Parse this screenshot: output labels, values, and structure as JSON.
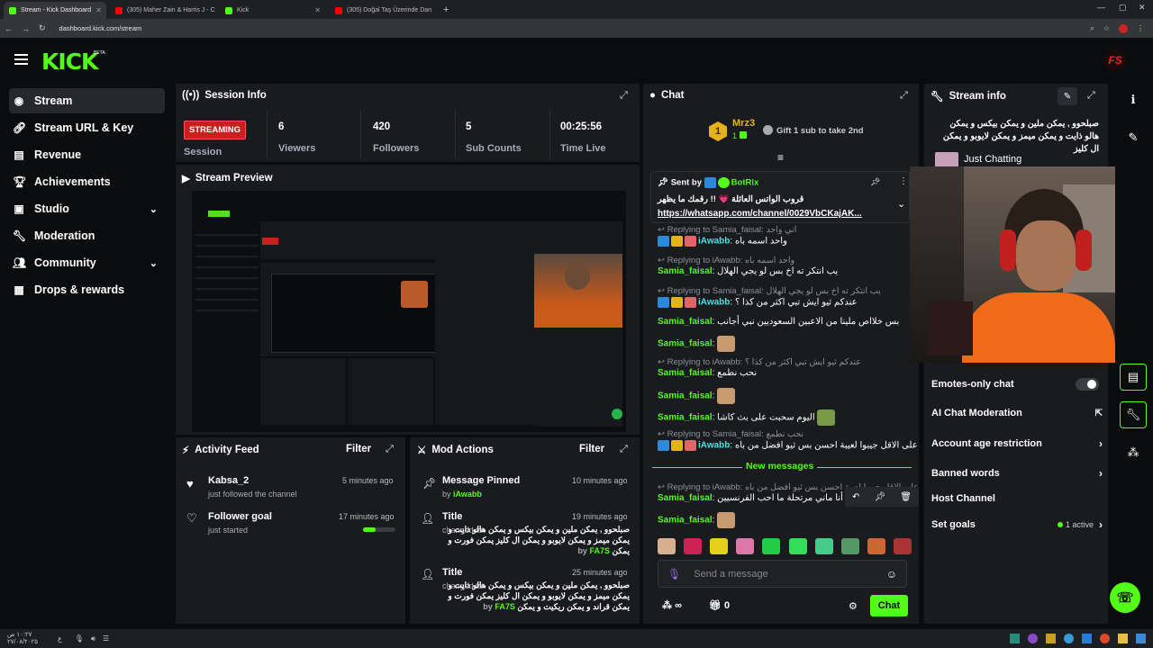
{
  "browser": {
    "tabs": [
      {
        "title": "Stream - Kick Dashboard",
        "icon_color": "#53fc18",
        "active": true
      },
      {
        "title": "(305) Maher Zain & Harris J - C",
        "icon_color": "#ff0000",
        "active": false
      },
      {
        "title": "Kick",
        "icon_color": "#53fc18",
        "active": false
      },
      {
        "title": "(305) Doğal Taş Üzerinde Dan",
        "icon_color": "#ff0000",
        "active": false
      }
    ],
    "new_tab": "+",
    "url": "dashboard.kick.com/stream"
  },
  "header": {
    "logo": "KICK",
    "beta": "BETA",
    "avatar_text": "FS"
  },
  "sidebar": {
    "items": [
      {
        "label": "Stream",
        "icon": "stream-icon"
      },
      {
        "label": "Stream URL & Key",
        "icon": "link-icon"
      },
      {
        "label": "Revenue",
        "icon": "chart-icon"
      },
      {
        "label": "Achievements",
        "icon": "trophy-icon"
      },
      {
        "label": "Studio",
        "icon": "studio-icon"
      },
      {
        "label": "Moderation",
        "icon": "wrench-icon"
      },
      {
        "label": "Community",
        "icon": "people-icon"
      },
      {
        "label": "Drops & rewards",
        "icon": "drops-icon"
      }
    ]
  },
  "session": {
    "title": "Session Info",
    "status": "STREAMING",
    "status_label": "Session",
    "stats": [
      {
        "value": "6",
        "label": "Viewers"
      },
      {
        "value": "420",
        "label": "Followers"
      },
      {
        "value": "5",
        "label": "Sub Counts"
      },
      {
        "value": "00:25:56",
        "label": "Time Live"
      }
    ]
  },
  "preview": {
    "title": "Stream Preview"
  },
  "activity": {
    "title": "Activity Feed",
    "filter": "Filter",
    "items": [
      {
        "title": "Kabsa_2",
        "sub": "just followed the channel",
        "time": "5 minutes ago"
      },
      {
        "title": "Follower goal",
        "sub": "just started",
        "time": "17 minutes ago",
        "progress": 0.4
      }
    ]
  },
  "mod": {
    "title": "Mod Actions",
    "filter": "Filter",
    "items": [
      {
        "title": "Message Pinned",
        "by_prefix": "by",
        "by": "iAwabb",
        "time": "10 minutes ago"
      },
      {
        "title": "Title",
        "changed": "changed to",
        "text": "صبلحوو , يمكن ملين و يمكن بيكس و يمكن هالو ذايت و يمكن ميمز و يمكن لايوبو و يمكن ال كليز يمكن فورت و يمكن",
        "by_prefix": "by",
        "by": "FA7S",
        "time": "19 minutes ago"
      },
      {
        "title": "Title",
        "changed": "changed to",
        "text": "صبلحوو , يمكن ملين و يمكن بيكس و يمكن هالو ذايت و يمكن ميمز و يمكن لايوبو و يمكن ال كليز يمكن فورت و يمكن قراند و يمكن ريكيت و يمكن",
        "by_prefix": "by",
        "by": "FA7S",
        "time": "25 minutes ago"
      }
    ]
  },
  "chat": {
    "title": "Chat",
    "top_gifter": {
      "rank": "1",
      "name": "Mrz3",
      "count": "1"
    },
    "gift_text": "Gift 1 sub to take 2nd",
    "pinned": {
      "sent_by_label": "Sent by",
      "sender": "BotRix",
      "line1": "قروب الواتس العائلة 💗 !! رقمك ما يظهر",
      "link": "https://whatsapp.com/channel/0029VbCKajAK..."
    },
    "new_messages": "New messages",
    "input_placeholder": "Send a message",
    "points": "0",
    "send_button": "Chat",
    "infinity": "∞"
  },
  "stream_info": {
    "title": "Stream info",
    "description": "صبلحوو , يمكن ملين و يمكن بيكس و يمكن هالو ذايت و يمكن ميمز و يمكن لايوبو و يمكن ال كليز",
    "category": "Just Chatting",
    "settings": [
      {
        "label": "Emotes-only chat"
      },
      {
        "label": "AI Chat Moderation"
      },
      {
        "label": "Account age restriction"
      },
      {
        "label": "Banned words"
      },
      {
        "label": "Host Channel"
      },
      {
        "label": "Set goals",
        "extra": "1 active"
      }
    ]
  },
  "taskbar": {
    "time": "١٠:٢٧ ص",
    "date": "٢٧/٠٨/٢٠٢٥",
    "lang": "ع"
  }
}
